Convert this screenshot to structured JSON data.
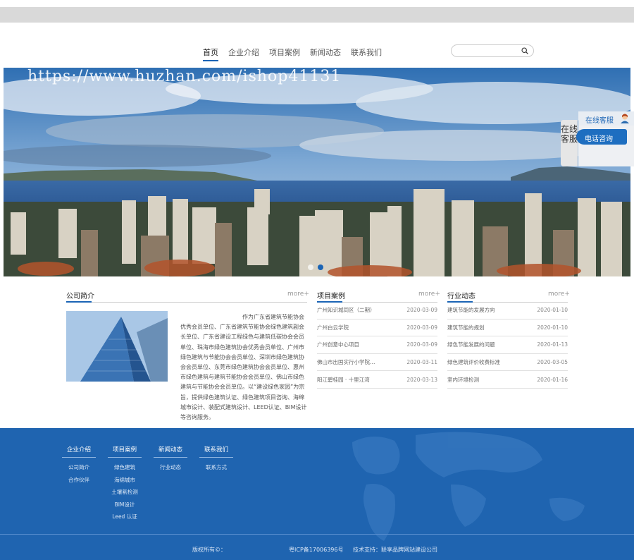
{
  "nav": {
    "items": [
      "首页",
      "企业介绍",
      "项目案例",
      "新闻动态",
      "联系我们"
    ],
    "search_placeholder": ""
  },
  "banner": {
    "watermark": "https://www.huzhan.com/ishop41131"
  },
  "float_service": {
    "tab": "在线客服",
    "head": "在线客服",
    "phone": "电话咨询"
  },
  "intro": {
    "title": "公司简介",
    "more": "more+",
    "text": "作为广东省建筑节能协会优秀会员单位、广东省建筑节能协会绿色建筑副会长单位、广东省建设工程绿色与建筑低碳协会会员单位、珠海市绿色建筑协会优秀会员单位、广州市绿色建筑与节能协会会员单位、深圳市绿色建筑协会会员单位、东莞市绿色建筑协会会员单位、惠州市绿色建筑与建筑节能协会会员单位、佛山市绿色建筑与节能协会会员单位。以“建设绿色家园”为宗旨，提供绿色建筑认证、绿色建筑项目咨询、海绵城市设计、装配式建筑设计、LEED认证、BIM设计等咨询服务。"
  },
  "projects": {
    "title": "项目案例",
    "more": "more+",
    "rows": [
      {
        "t": "广州知识城同区（二期）",
        "d": "2020-03-09"
      },
      {
        "t": "广州白云学院",
        "d": "2020-03-09"
      },
      {
        "t": "广州创意中心项目",
        "d": "2020-03-09"
      },
      {
        "t": "佛山市出国实行小学院…",
        "d": "2020-03-11"
      },
      {
        "t": "阳江碧桂园 · 十里江湾",
        "d": "2020-03-13"
      }
    ]
  },
  "news": {
    "title": "行业动态",
    "more": "more+",
    "rows": [
      {
        "t": "建筑节能的发展方向",
        "d": "2020-01-10"
      },
      {
        "t": "建筑节能的规划",
        "d": "2020-01-10"
      },
      {
        "t": "绿色节能发展的问题",
        "d": "2020-01-13"
      },
      {
        "t": "绿色建筑评价收费标准",
        "d": "2020-03-05"
      },
      {
        "t": "室内环境检测",
        "d": "2020-01-16"
      }
    ]
  },
  "footer": {
    "cols": [
      {
        "h": "企业介绍",
        "items": [
          "公司简介",
          "合作伙伴"
        ]
      },
      {
        "h": "项目案例",
        "items": [
          "绿色建筑",
          "海绵城市",
          "土壤氡检测",
          "BIM设计",
          "Leed 认证"
        ]
      },
      {
        "h": "新闻动态",
        "items": [
          "行业动态"
        ]
      },
      {
        "h": "联系我们",
        "items": [
          "联系方式"
        ]
      }
    ],
    "copyright": "版权所有©：",
    "icp": "粤ICP备17006396号",
    "support": "技术支持：联享品牌网站建设公司"
  }
}
